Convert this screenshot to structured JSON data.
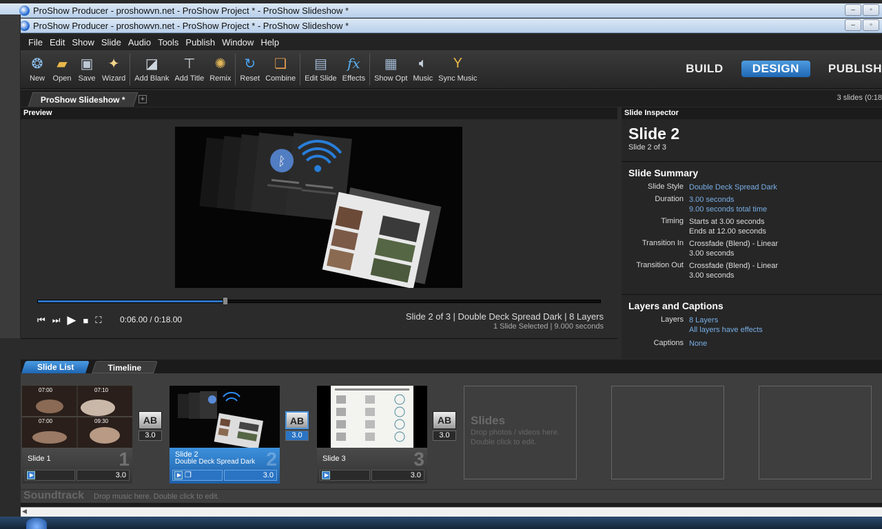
{
  "window": {
    "title_back": "ProShow Producer - proshowvn.net - ProShow Project * - ProShow Slideshow *",
    "title_front": "ProShow Producer - proshowvn.net - ProShow Project * - ProShow Slideshow *"
  },
  "menu": [
    "File",
    "Edit",
    "Show",
    "Slide",
    "Audio",
    "Tools",
    "Publish",
    "Window",
    "Help"
  ],
  "toolbar": {
    "groups": [
      [
        {
          "label": "New",
          "icon": "new-icon"
        },
        {
          "label": "Open",
          "icon": "open-icon"
        },
        {
          "label": "Save",
          "icon": "save-icon"
        },
        {
          "label": "Wizard",
          "icon": "wizard-icon"
        }
      ],
      [
        {
          "label": "Add Blank",
          "icon": "add-blank-icon"
        },
        {
          "label": "Add Title",
          "icon": "add-title-icon"
        },
        {
          "label": "Remix",
          "icon": "remix-icon"
        }
      ],
      [
        {
          "label": "Reset",
          "icon": "reset-icon"
        },
        {
          "label": "Combine",
          "icon": "combine-icon"
        }
      ],
      [
        {
          "label": "Edit Slide",
          "icon": "edit-slide-icon"
        },
        {
          "label": "Effects",
          "icon": "effects-icon"
        }
      ],
      [
        {
          "label": "Show Opt",
          "icon": "show-opt-icon"
        },
        {
          "label": "Music",
          "icon": "music-icon"
        },
        {
          "label": "Sync Music",
          "icon": "sync-music-icon"
        }
      ]
    ],
    "modes": [
      "BUILD",
      "DESIGN",
      "PUBLISH"
    ],
    "active_mode": "DESIGN"
  },
  "tabs": {
    "doc": "ProShow Slideshow *",
    "slide_count": "3 slides (0:18"
  },
  "preview": {
    "header": "Preview",
    "timecode": "0:06.00 / 0:18.00",
    "progress": 0.333,
    "info_line1": "Slide 2 of 3  |  Double Deck Spread Dark  |  8 Layers",
    "info_line2": "1 Slide Selected  |  9.000 seconds"
  },
  "inspector": {
    "header": "Slide Inspector",
    "title": "Slide 2",
    "subtitle": "Slide 2 of 3",
    "summary_title": "Slide Summary",
    "summary": [
      {
        "key": "Slide Style",
        "values": [
          "Double Deck Spread Dark"
        ],
        "link": true
      },
      {
        "key": "Duration",
        "values": [
          "3.00 seconds",
          "9.00 seconds total time"
        ],
        "link": true
      },
      {
        "key": "Timing",
        "values": [
          "Starts at 3.00 seconds",
          "Ends at 12.00 seconds"
        ],
        "link": false
      },
      {
        "key": "Transition In",
        "values": [
          "Crossfade (Blend) - Linear",
          "3.00 seconds"
        ],
        "link": false
      },
      {
        "key": "Transition Out",
        "values": [
          "Crossfade (Blend) - Linear",
          "3.00 seconds"
        ],
        "link": false
      }
    ],
    "layers_title": "Layers and Captions",
    "layers": [
      {
        "key": "Layers",
        "values": [
          "8 Layers",
          "All layers have effects"
        ],
        "link": true
      },
      {
        "key": "Captions",
        "values": [
          "None"
        ],
        "link": true
      }
    ]
  },
  "slide_list": {
    "tabs": [
      "Slide List",
      "Timeline"
    ],
    "active_tab": "Slide List",
    "slides": [
      {
        "name": "Slide 1",
        "style": "",
        "num": "1",
        "duration": "3.0",
        "selected": false
      },
      {
        "name": "Slide 2",
        "style": "Double Deck Spread Dark",
        "num": "2",
        "duration": "3.0",
        "selected": true
      },
      {
        "name": "Slide 3",
        "style": "",
        "num": "3",
        "duration": "3.0",
        "selected": false
      }
    ],
    "transitions": [
      {
        "label": "AB",
        "time": "3.0",
        "selected": false
      },
      {
        "label": "AB",
        "time": "3.0",
        "selected": true
      },
      {
        "label": "AB",
        "time": "3.0",
        "selected": false
      }
    ],
    "thumb1_times": [
      "07:00",
      "07:10",
      "07:00",
      "09:30"
    ],
    "empty_title": "Slides",
    "empty_hint1": "Drop photos / videos here.",
    "empty_hint2": "Double click to edit."
  },
  "soundtrack": {
    "title": "Soundtrack",
    "hint": "Drop music here.  Double click to edit."
  },
  "colors": {
    "accent": "#2b74c4",
    "link": "#78aee6"
  }
}
